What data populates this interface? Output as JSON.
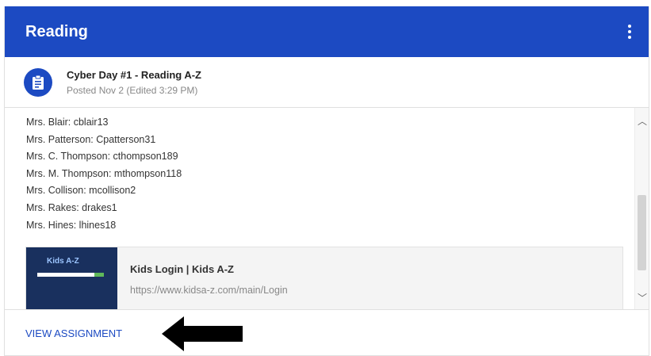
{
  "header": {
    "title": "Reading",
    "menu_icon": "more-vert-icon",
    "color": "#1c4ac2"
  },
  "post": {
    "icon": "assignment-icon",
    "title": "Cyber Day #1 - Reading A-Z",
    "meta": "Posted Nov 2 (Edited 3:29 PM)"
  },
  "body": {
    "lines": [
      "Mrs. Blair: cblair13",
      "Mrs. Patterson: Cpatterson31",
      "Mrs. C. Thompson: cthompson189",
      "Mrs. M. Thompson: mthompson118",
      "Mrs. Collison: mcollison2",
      "Mrs. Rakes: drakes1",
      "Mrs. Hines: lhines18"
    ]
  },
  "link": {
    "thumbnail_text": "Kids A-Z",
    "title": "Kids Login | Kids A-Z",
    "url": "https://www.kidsa-z.com/main/Login"
  },
  "footer": {
    "button_label": "VIEW ASSIGNMENT",
    "arrow_icon": "left-arrow-icon"
  }
}
